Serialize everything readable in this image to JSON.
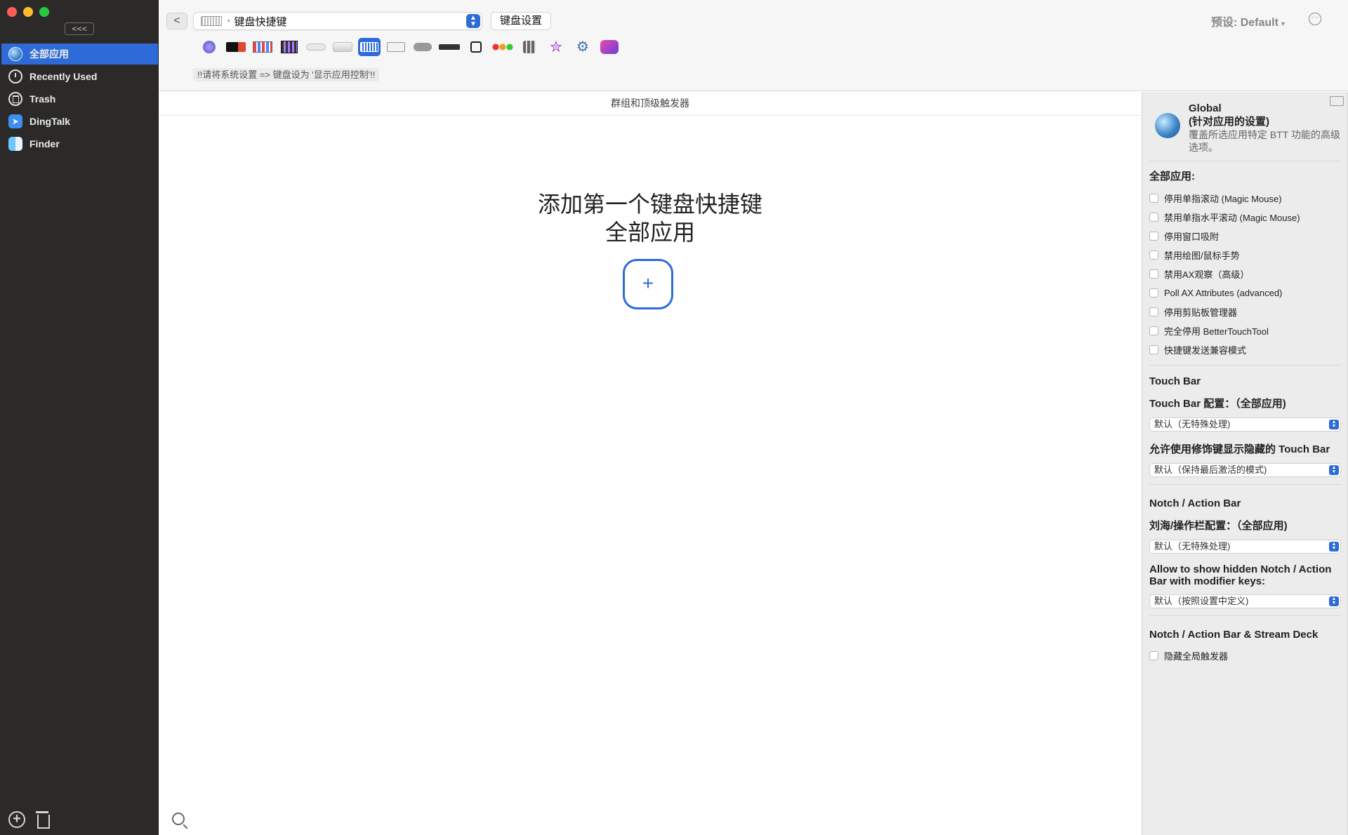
{
  "sidebar": {
    "collapse_label": "<<<",
    "items": [
      {
        "label": "全部应用",
        "icon": "globe-icon",
        "active": true
      },
      {
        "label": "Recently Used",
        "icon": "clock-icon",
        "active": false
      },
      {
        "label": "Trash",
        "icon": "trash-icon",
        "active": false
      },
      {
        "label": "DingTalk",
        "icon": "dingtalk-icon",
        "active": false
      },
      {
        "label": "Finder",
        "icon": "finder-icon",
        "active": false
      }
    ]
  },
  "toolbar": {
    "back_label": "<",
    "trigger_type": "键盘快捷键",
    "keyboard_settings_label": "键盘设置",
    "preset_label": "预设: Default",
    "preset_caret": "▾",
    "more_label": "···",
    "hint": "!!请将系统设置 => 键盘设为 '显示应用控制'!!",
    "devices": [
      "all-triggers-icon",
      "touch-bar-icon",
      "ui-element-icon",
      "elgato-icon",
      "magic-mouse-icon",
      "trackpad-icon",
      "keyboard-icon",
      "key-sequence-icon",
      "normal-mouse-icon",
      "siri-remote-icon",
      "notch-icon",
      "other-triggers-icon",
      "stream-deck-icon",
      "star-icon",
      "automation-icon",
      "floating-menu-icon"
    ],
    "active_device_index": 6
  },
  "main": {
    "group_header": "群组和顶级触发器",
    "empty_line1": "添加第一个键盘快捷键",
    "empty_line2": "全部应用",
    "add_label": "+"
  },
  "panel": {
    "global_title": "Global",
    "global_subtitle": "(针对应用的设置)",
    "global_desc": "覆盖所选应用特定 BTT 功能的高级选项。",
    "all_apps_title": "全部应用:",
    "checkboxes": [
      "停用单指滚动 (Magic Mouse)",
      "禁用单指水平滚动 (Magic Mouse)",
      "停用窗口吸附",
      "禁用绘图/鼠标手势",
      "禁用AX观察（高级）",
      "Poll AX Attributes (advanced)",
      "停用剪贴板管理器",
      "完全停用 BetterTouchTool",
      "快捷键发送兼容模式"
    ],
    "touchbar_title": "Touch Bar",
    "touchbar_config_label": "Touch Bar 配置：（全部应用)",
    "touchbar_config_value": "默认（无特殊处理)",
    "touchbar_hidden_label": "允许使用修饰键显示隐藏的 Touch Bar",
    "touchbar_hidden_value": "默认（保持最后激活的模式)",
    "notch_title": "Notch / Action Bar",
    "notch_config_label": "刘海/操作栏配置：（全部应用)",
    "notch_config_value": "默认（无特殊处理)",
    "notch_hidden_label": "Allow to show hidden Notch / Action Bar with modifier keys:",
    "notch_hidden_value": "默认（按照设置中定义)",
    "streamdeck_title": "Notch / Action Bar & Stream Deck",
    "hide_global_label": "隐藏全局触发器",
    "stepper_glyph": "▲▼"
  },
  "colors": {
    "accent": "#2f6bd8",
    "sidebar_bg": "#2b2a29",
    "panel_bg": "#ececec"
  }
}
